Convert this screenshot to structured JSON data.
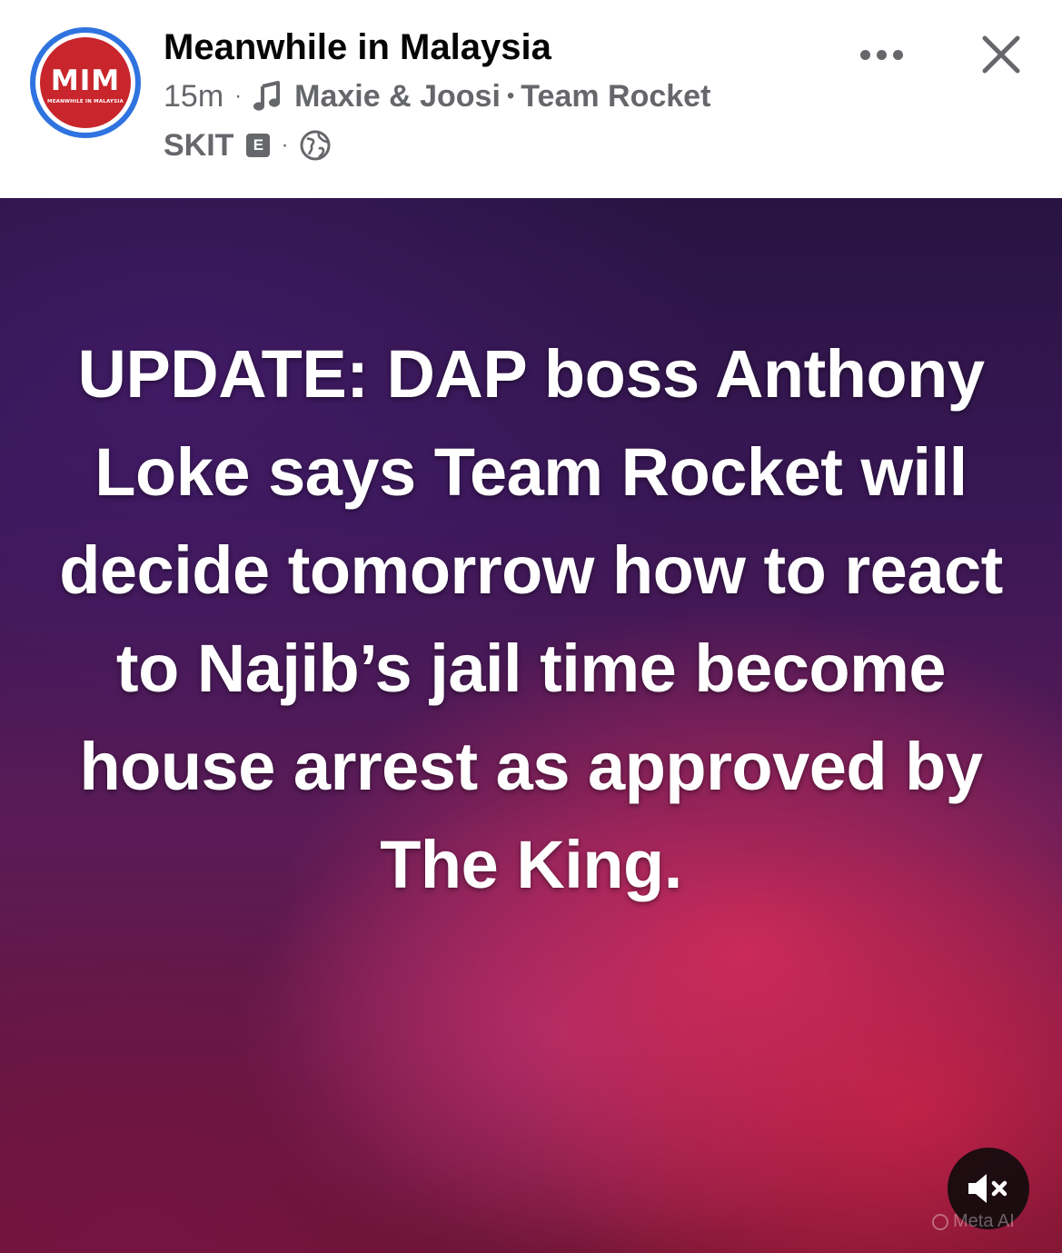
{
  "post": {
    "page_name": "Meanwhile in Malaysia",
    "avatar": {
      "logo_text": "MIM",
      "logo_subtext": "MEANWHILE IN MALAYSIA",
      "ring_color": "#2f73e0",
      "logo_color": "#c8262c"
    },
    "time_ago": "15m",
    "meta_separator": "·",
    "music_icon": "music-note-icon",
    "song_artist": "Maxie & Joosi",
    "song_separator": "•",
    "song_title": "Team Rocket",
    "song_label": "SKIT",
    "explicit_badge": "E",
    "privacy_icon": "globe-icon",
    "body_text": "UPDATE: DAP boss Anthony Loke says Team Rocket will decide tomorrow how to react to Najib’s jail time become house arrest as approved by The King.",
    "mute_icon": "speaker-muted-icon",
    "watermark": "Meta AI"
  },
  "header_actions": {
    "more_icon": "more-options-icon",
    "close_icon": "close-icon"
  }
}
